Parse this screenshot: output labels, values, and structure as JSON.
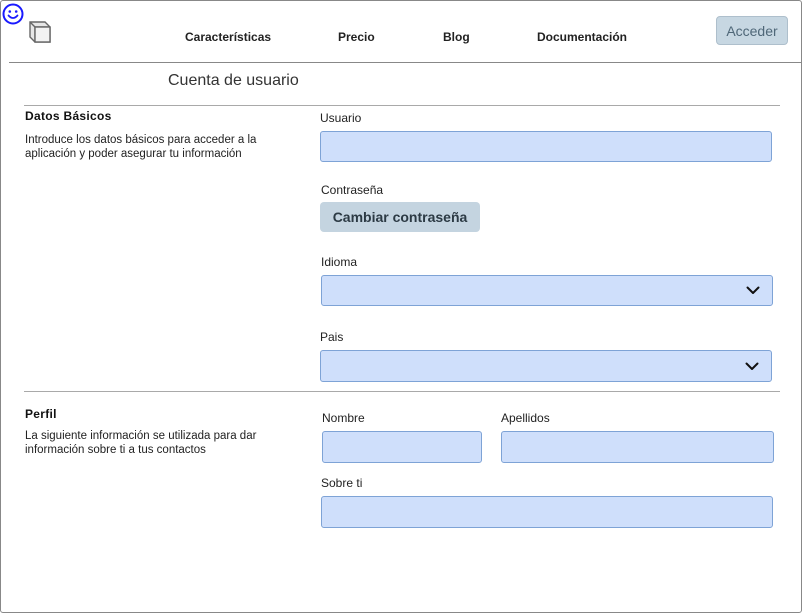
{
  "header": {
    "nav": [
      {
        "label": "Características"
      },
      {
        "label": "Precio"
      },
      {
        "label": "Blog"
      },
      {
        "label": "Documentación"
      }
    ],
    "login_label": "Acceder"
  },
  "page": {
    "title": "Cuenta de usuario"
  },
  "basic": {
    "title": "Datos Básicos",
    "desc_line1": "Introduce los datos básicos para acceder a la",
    "desc_line2": "aplicación y poder asegurar tu información",
    "username_label": "Usuario",
    "username_value": "",
    "password_label": "Contraseña",
    "change_password_label": "Cambiar contraseña",
    "language_label": "Idioma",
    "language_value": "",
    "country_label": "Pais",
    "country_value": ""
  },
  "profile": {
    "title": "Perfil",
    "desc_line1": "La siguiente información se utilizada para dar",
    "desc_line2": "información sobre ti a tus contactos",
    "first_name_label": "Nombre",
    "first_name_value": "",
    "last_name_label": "Apellidos",
    "last_name_value": "",
    "about_label": "Sobre ti",
    "about_value": ""
  },
  "colors": {
    "input_fill": "#cfdffb",
    "input_border": "#7ea3d6",
    "button_fill": "#c4d4e0",
    "smiley": "#1a1aff"
  }
}
